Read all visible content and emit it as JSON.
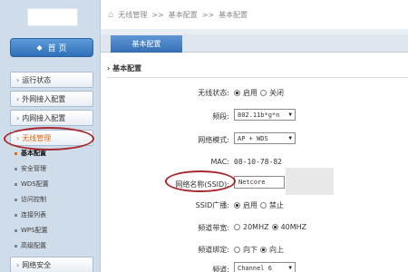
{
  "sidebar": {
    "home_label": "首 页",
    "items": [
      {
        "label": "运行状态"
      },
      {
        "label": "外网接入配置"
      },
      {
        "label": "内网接入配置"
      },
      {
        "label": "无线管理"
      },
      {
        "label": "网络安全"
      }
    ],
    "subitems": [
      {
        "label": "基本配置"
      },
      {
        "label": "安全管理"
      },
      {
        "label": "WDS配置"
      },
      {
        "label": "访问控制"
      },
      {
        "label": "连接列表"
      },
      {
        "label": "WPS配置"
      },
      {
        "label": "高级配置"
      }
    ]
  },
  "breadcrumb": {
    "part1": "无线管理",
    "sep1": ">>",
    "part2": "基本配置",
    "sep2": ">>",
    "part3": "基本配置"
  },
  "tab": {
    "label": "基本配置"
  },
  "section": {
    "title": "基本配置"
  },
  "form": {
    "wireless_status": {
      "label": "无线状态:",
      "opt_on": "启用",
      "opt_off": "关闭"
    },
    "band": {
      "label": "频段:",
      "value": "802.11b*g*n"
    },
    "net_mode": {
      "label": "网络模式:",
      "value": "AP + WDS"
    },
    "mac": {
      "label": "MAC:",
      "value": "08-10-78-82"
    },
    "ssid": {
      "label": "网络名称(SSID):",
      "value": "Netcore"
    },
    "ssid_broadcast": {
      "label": "SSID广播:",
      "opt_on": "启用",
      "opt_off": "禁止"
    },
    "bandwidth": {
      "label": "频道带宽:",
      "opt_20": "20MHZ",
      "opt_40": "40MHZ"
    },
    "channel_bind": {
      "label": "频道绑定:",
      "opt_down": "向下",
      "opt_up": "向上"
    },
    "channel": {
      "label": "频道:",
      "value": "Channel 6"
    }
  },
  "colors": {
    "sidebar_bg": "#cfdcea",
    "accent_blue": "#356fb3",
    "active_orange": "#e86a12",
    "highlight_red": "#a8282e"
  }
}
